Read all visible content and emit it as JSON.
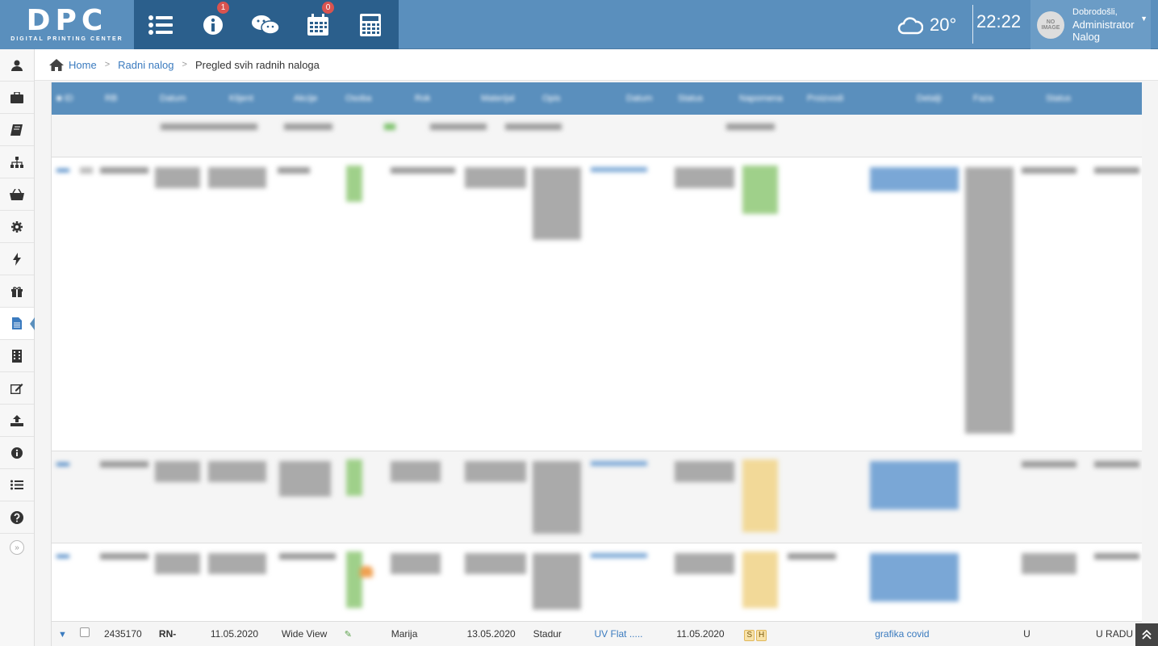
{
  "brand": {
    "logo_text": "DPC",
    "logo_sub": "DIGITAL PRINTING CENTER"
  },
  "topnav": [
    {
      "icon": "list-icon",
      "badge": ""
    },
    {
      "icon": "info-icon",
      "badge": "1"
    },
    {
      "icon": "chat-icon",
      "badge": ""
    },
    {
      "icon": "calendar-icon",
      "badge": "0"
    },
    {
      "icon": "calculator-icon",
      "badge": ""
    }
  ],
  "weather": {
    "temp": "20°",
    "icon": "cloud-icon"
  },
  "clock": "22:22",
  "user": {
    "greeting": "Dobrodošli,",
    "name_line1": "Administrator",
    "name_line2": "Nalog",
    "avatar_text": "NO IMAGE"
  },
  "sidebar": [
    {
      "icon": "user-icon"
    },
    {
      "icon": "briefcase-icon"
    },
    {
      "icon": "book-icon"
    },
    {
      "icon": "sitemap-icon"
    },
    {
      "icon": "basket-icon"
    },
    {
      "icon": "gear-icon"
    },
    {
      "icon": "bolt-icon"
    },
    {
      "icon": "gift-icon"
    },
    {
      "icon": "document-icon",
      "active": true
    },
    {
      "icon": "building-icon"
    },
    {
      "icon": "edit-icon"
    },
    {
      "icon": "upload-icon"
    },
    {
      "icon": "info-icon"
    },
    {
      "icon": "list-icon"
    },
    {
      "icon": "help-icon"
    }
  ],
  "breadcrumb": {
    "home": "Home",
    "section": "Radni nalog",
    "current": "Pregled svih radnih naloga"
  },
  "table": {
    "headers": [
      "■ ID",
      "RB",
      "Datum",
      "Klijent",
      "Akcije",
      "Osoba",
      "Rok",
      "Materijal",
      "Opis",
      "Datum",
      "Status",
      "Napomena",
      "Proizvodi",
      "Detalji",
      "Faza",
      "Status"
    ],
    "visible_row": {
      "id": "2435170",
      "rb": "RN-",
      "datum": "11.05.2020",
      "klijent": "Wide View",
      "osoba": "Marija",
      "rok": "13.05.2020",
      "materijal": "Stadur",
      "opis": "UV Flat .....",
      "datum2": "11.05.2020",
      "tag1": "S",
      "tag2": "H",
      "proizvod": "grafika covid",
      "faza": "U",
      "status": "U RADU"
    }
  }
}
